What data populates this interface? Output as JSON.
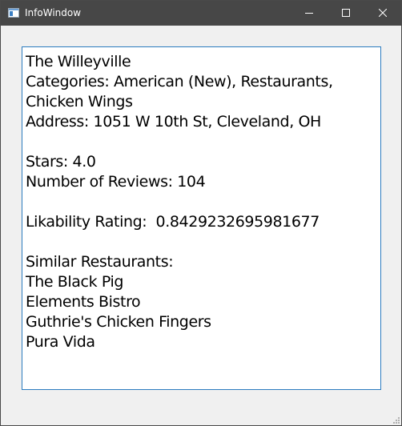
{
  "window": {
    "title": "InfoWindow",
    "controls": {
      "minimize_icon": "minimize-icon",
      "maximize_icon": "maximize-icon",
      "close_icon": "close-icon"
    },
    "colors": {
      "titlebar": "#474747",
      "background": "#f0f0f0",
      "content_border": "#2b7bbf"
    }
  },
  "info": {
    "name": "The Willeyville",
    "categories_line1": "Categories: American (New), Restaurants,",
    "categories_line2": "Chicken Wings",
    "address": "Address: 1051 W 10th St, Cleveland, OH",
    "stars": "Stars: 4.0",
    "reviews": "Number of Reviews: 104",
    "likability": "Likability Rating:  0.8429232695981677",
    "similar_header": "Similar Restaurants:",
    "similar": [
      "The Black Pig",
      "Elements Bistro",
      "Guthrie's Chicken Fingers",
      "Pura Vida"
    ]
  }
}
